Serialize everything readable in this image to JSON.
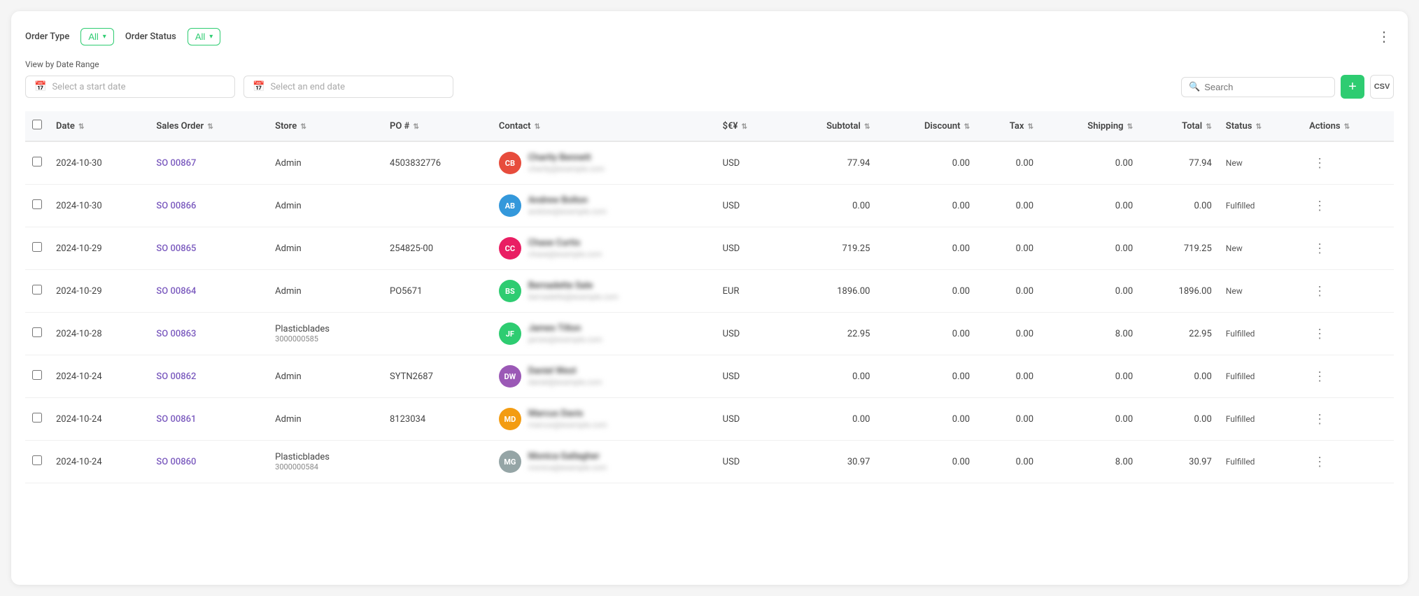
{
  "filters": {
    "order_type_label": "Order Type",
    "order_type_value": "All",
    "order_status_label": "Order Status",
    "order_status_value": "All"
  },
  "date_range": {
    "label": "View by Date Range",
    "start_placeholder": "Select a start date",
    "end_placeholder": "Select an end date"
  },
  "search": {
    "placeholder": "Search"
  },
  "buttons": {
    "add": "+",
    "csv": "CSV",
    "more": "⋮"
  },
  "table": {
    "columns": [
      {
        "key": "date",
        "label": "Date"
      },
      {
        "key": "sales_order",
        "label": "Sales Order"
      },
      {
        "key": "store",
        "label": "Store"
      },
      {
        "key": "po",
        "label": "PO #"
      },
      {
        "key": "contact",
        "label": "Contact"
      },
      {
        "key": "currency",
        "label": "$€¥"
      },
      {
        "key": "subtotal",
        "label": "Subtotal"
      },
      {
        "key": "discount",
        "label": "Discount"
      },
      {
        "key": "tax",
        "label": "Tax"
      },
      {
        "key": "shipping",
        "label": "Shipping"
      },
      {
        "key": "total",
        "label": "Total"
      },
      {
        "key": "status",
        "label": "Status"
      },
      {
        "key": "actions",
        "label": "Actions"
      }
    ],
    "rows": [
      {
        "date": "2024-10-30",
        "sales_order": "SO 00867",
        "store": "Admin",
        "store_sub": "",
        "po": "4503832776",
        "contact_initials": "CB",
        "contact_name": "Charity Bennett",
        "contact_sub": "charity@example.com",
        "avatar_color": "#e74c3c",
        "currency": "USD",
        "subtotal": "77.94",
        "discount": "0.00",
        "tax": "0.00",
        "shipping": "0.00",
        "total": "77.94",
        "status": "New"
      },
      {
        "date": "2024-10-30",
        "sales_order": "SO 00866",
        "store": "Admin",
        "store_sub": "",
        "po": "",
        "contact_initials": "AB",
        "contact_name": "Andrew Bolton",
        "contact_sub": "andrew@example.com",
        "avatar_color": "#3498db",
        "currency": "USD",
        "subtotal": "0.00",
        "discount": "0.00",
        "tax": "0.00",
        "shipping": "0.00",
        "total": "0.00",
        "status": "Fulfilled"
      },
      {
        "date": "2024-10-29",
        "sales_order": "SO 00865",
        "store": "Admin",
        "store_sub": "",
        "po": "254825-00",
        "contact_initials": "CC",
        "contact_name": "Chase Curtis",
        "contact_sub": "chase@example.com",
        "avatar_color": "#e91e63",
        "currency": "USD",
        "subtotal": "719.25",
        "discount": "0.00",
        "tax": "0.00",
        "shipping": "0.00",
        "total": "719.25",
        "status": "New"
      },
      {
        "date": "2024-10-29",
        "sales_order": "SO 00864",
        "store": "Admin",
        "store_sub": "",
        "po": "PO5671",
        "contact_initials": "BS",
        "contact_name": "Bernadette Sale",
        "contact_sub": "bernadette@example.com",
        "avatar_color": "#2ecc71",
        "currency": "EUR",
        "subtotal": "1896.00",
        "discount": "0.00",
        "tax": "0.00",
        "shipping": "0.00",
        "total": "1896.00",
        "status": "New"
      },
      {
        "date": "2024-10-28",
        "sales_order": "SO 00863",
        "store": "Plasticblades",
        "store_sub": "3000000585",
        "po": "",
        "contact_initials": "JF",
        "contact_name": "James Tilton",
        "contact_sub": "james@example.com",
        "avatar_color": "#2ecc71",
        "currency": "USD",
        "subtotal": "22.95",
        "discount": "0.00",
        "tax": "0.00",
        "shipping": "8.00",
        "total": "22.95",
        "status": "Fulfilled"
      },
      {
        "date": "2024-10-24",
        "sales_order": "SO 00862",
        "store": "Admin",
        "store_sub": "",
        "po": "SYTN2687",
        "contact_initials": "DW",
        "contact_name": "Daniel West",
        "contact_sub": "daniel@example.com",
        "avatar_color": "#9b59b6",
        "currency": "USD",
        "subtotal": "0.00",
        "discount": "0.00",
        "tax": "0.00",
        "shipping": "0.00",
        "total": "0.00",
        "status": "Fulfilled"
      },
      {
        "date": "2024-10-24",
        "sales_order": "SO 00861",
        "store": "Admin",
        "store_sub": "",
        "po": "8123034",
        "contact_initials": "MD",
        "contact_name": "Marcus Davis",
        "contact_sub": "marcus@example.com",
        "avatar_color": "#f39c12",
        "currency": "USD",
        "subtotal": "0.00",
        "discount": "0.00",
        "tax": "0.00",
        "shipping": "0.00",
        "total": "0.00",
        "status": "Fulfilled"
      },
      {
        "date": "2024-10-24",
        "sales_order": "SO 00860",
        "store": "Plasticblades",
        "store_sub": "3000000584",
        "po": "",
        "contact_initials": "MG",
        "contact_name": "Monica Gallagher",
        "contact_sub": "monica@example.com",
        "avatar_color": "#95a5a6",
        "currency": "USD",
        "subtotal": "30.97",
        "discount": "0.00",
        "tax": "0.00",
        "shipping": "8.00",
        "total": "30.97",
        "status": "Fulfilled"
      }
    ]
  }
}
